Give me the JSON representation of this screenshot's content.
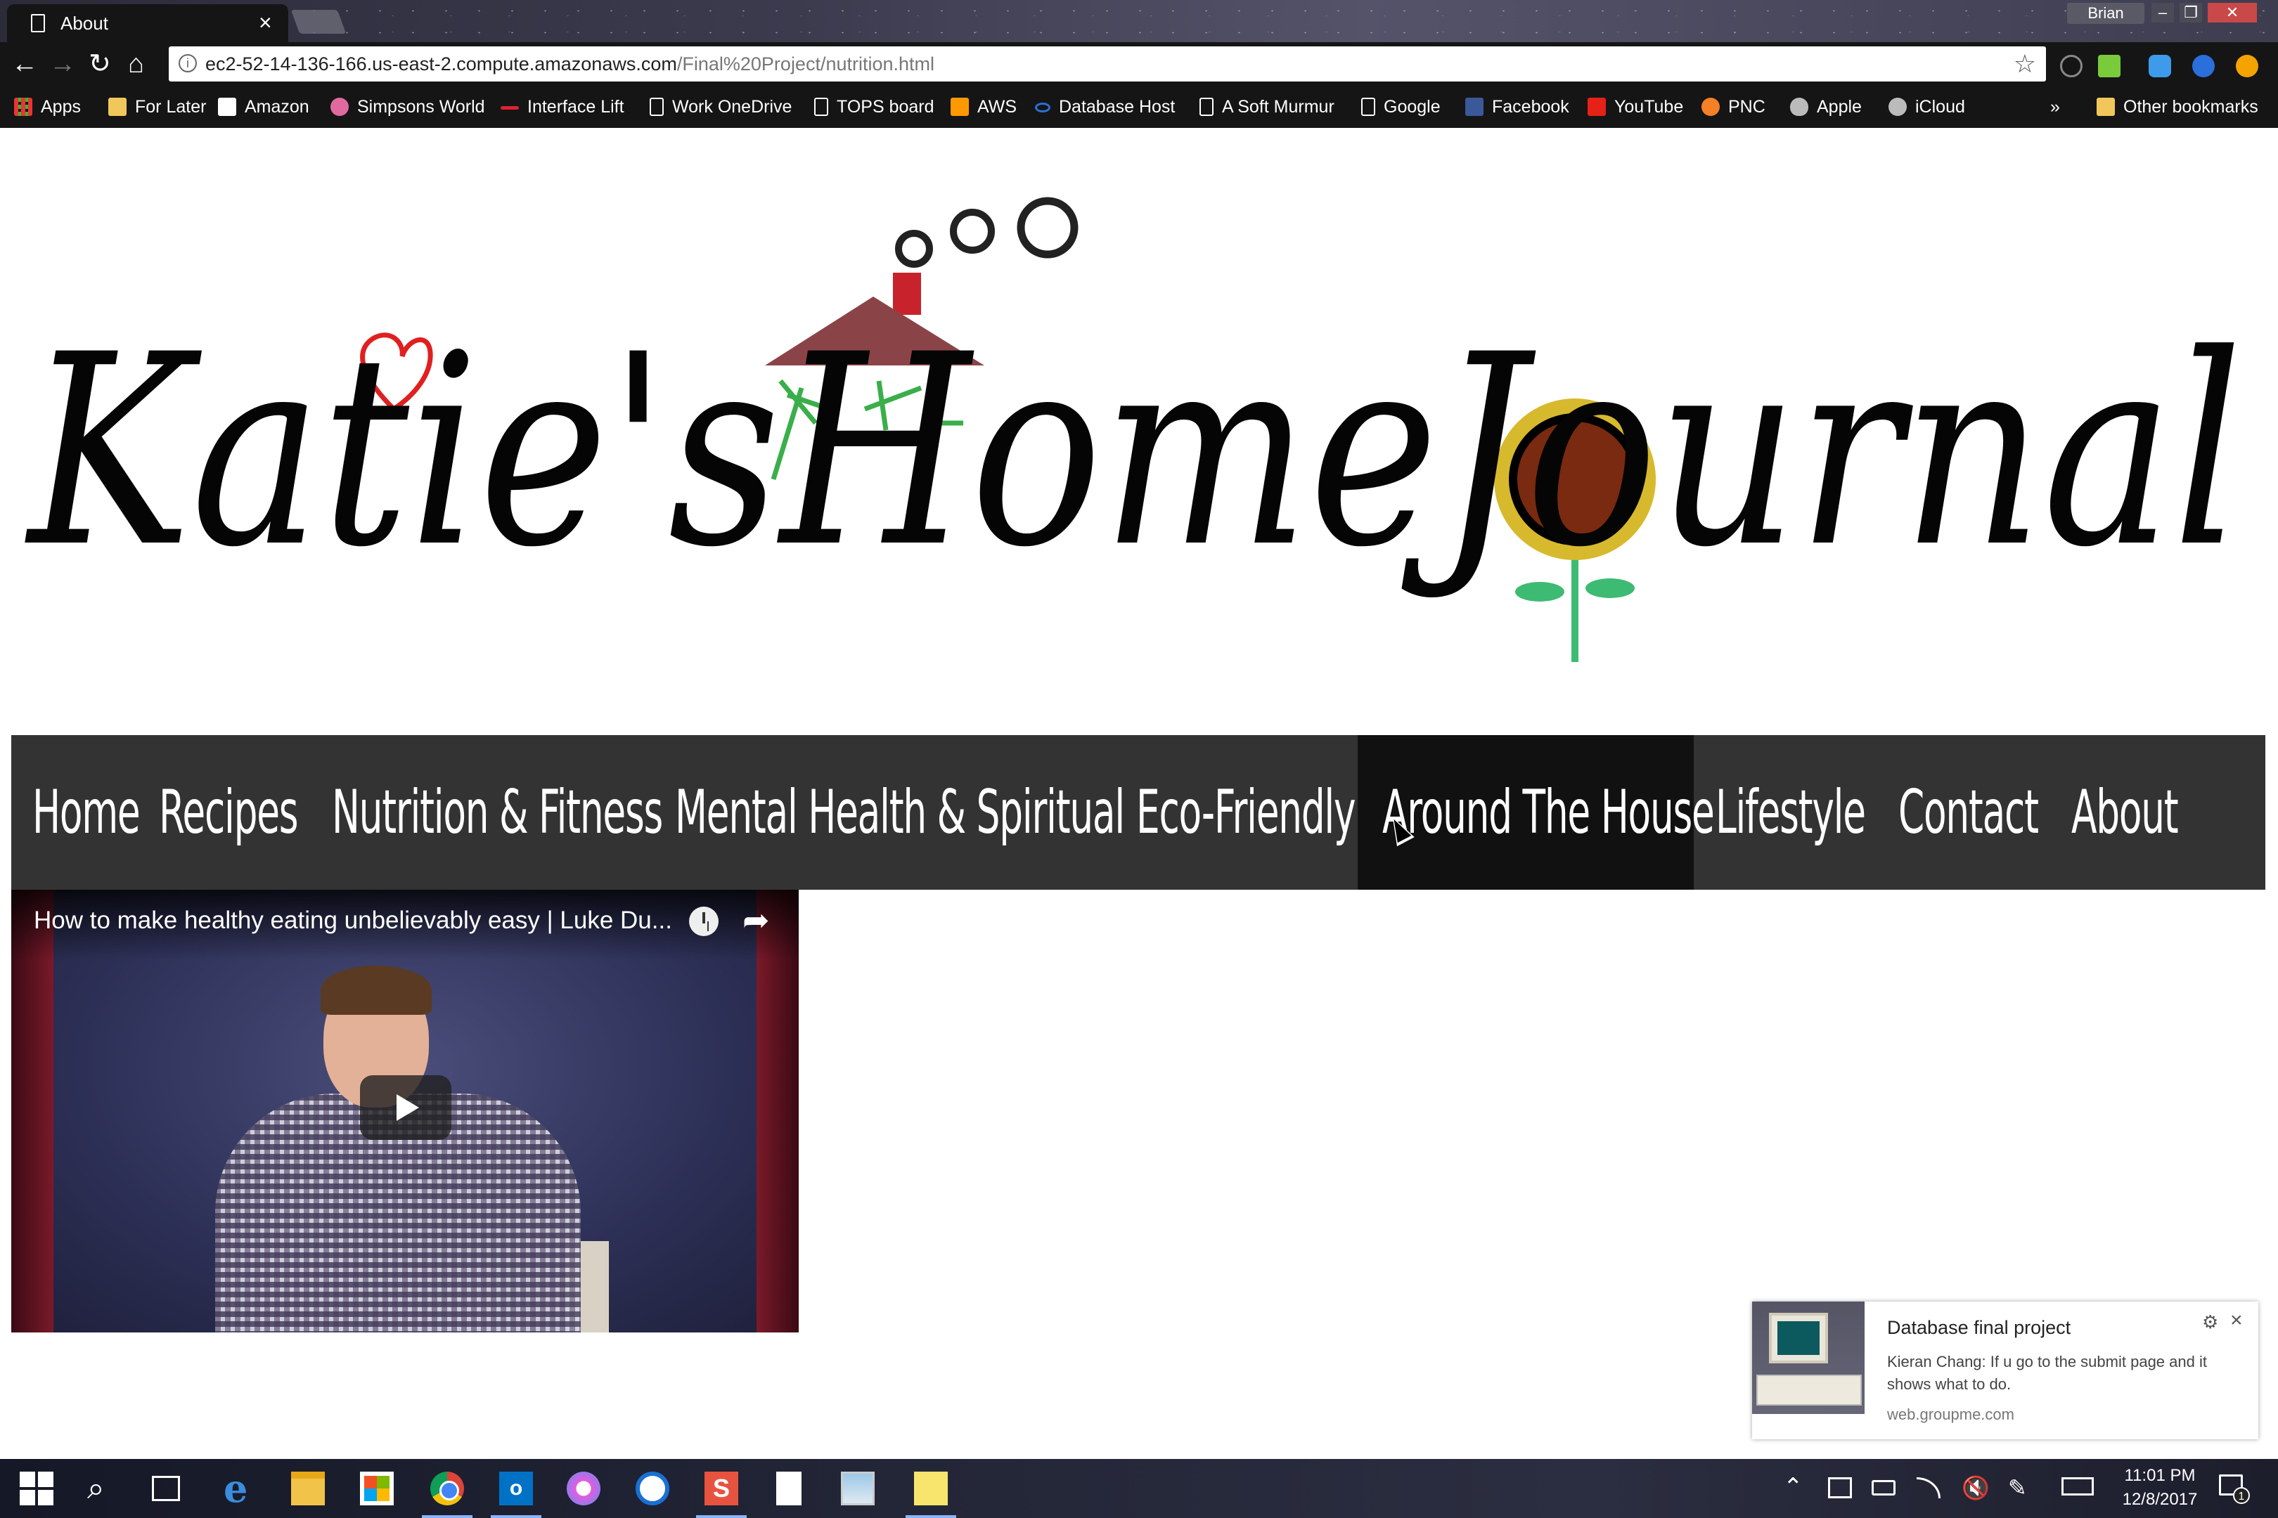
{
  "browser": {
    "tab_title": "About",
    "profile_name": "Brian",
    "url_host": "ec2-52-14-136-166.us-east-2.compute.amazonaws.com",
    "url_path": "/Final%20Project/nutrition.html",
    "bookmarks": [
      {
        "label": "Apps",
        "icon": "apps-grid-icon"
      },
      {
        "label": "For Later",
        "icon": "folder-icon"
      },
      {
        "label": "Amazon",
        "icon": "amazon-icon"
      },
      {
        "label": "Simpsons World",
        "icon": "simpsons-icon"
      },
      {
        "label": "Interface Lift",
        "icon": "interfacelift-icon"
      },
      {
        "label": "Work OneDrive",
        "icon": "page-icon"
      },
      {
        "label": "TOPS board",
        "icon": "page-icon"
      },
      {
        "label": "AWS",
        "icon": "aws-icon"
      },
      {
        "label": "Database Host",
        "icon": "infinity-icon"
      },
      {
        "label": "A Soft Murmur",
        "icon": "page-icon"
      },
      {
        "label": "Google",
        "icon": "page-icon"
      },
      {
        "label": "Facebook",
        "icon": "facebook-icon"
      },
      {
        "label": "YouTube",
        "icon": "youtube-icon"
      },
      {
        "label": "PNC",
        "icon": "pnc-icon"
      },
      {
        "label": "Apple",
        "icon": "apple-icon"
      },
      {
        "label": "iCloud",
        "icon": "icloud-icon"
      }
    ],
    "overflow_label": "»",
    "other_bookmarks": "Other bookmarks"
  },
  "site": {
    "title": "Katie'sHomeJournal",
    "nav": [
      {
        "label": "Home"
      },
      {
        "label": "Recipes"
      },
      {
        "label": "Nutrition & Fitness"
      },
      {
        "label": "Mental Health & Spiritual"
      },
      {
        "label": "Eco-Friendly"
      },
      {
        "label": "Around The House",
        "hover": true
      },
      {
        "label": "Lifestyle"
      },
      {
        "label": "Contact"
      },
      {
        "label": "About"
      }
    ],
    "video": {
      "title": "How to make healthy eating unbelievably easy | Luke Du..."
    }
  },
  "notification": {
    "title": "Database final project",
    "body": "Kieran Chang: If u go to the submit page and it shows what to do.",
    "source": "web.groupme.com"
  },
  "taskbar": {
    "time": "11:01 PM",
    "date": "12/8/2017",
    "notification_count": "1"
  },
  "colors": {
    "nav_bg": "#333333",
    "nav_hover_bg": "#111111",
    "chrome_dark": "#151515"
  }
}
